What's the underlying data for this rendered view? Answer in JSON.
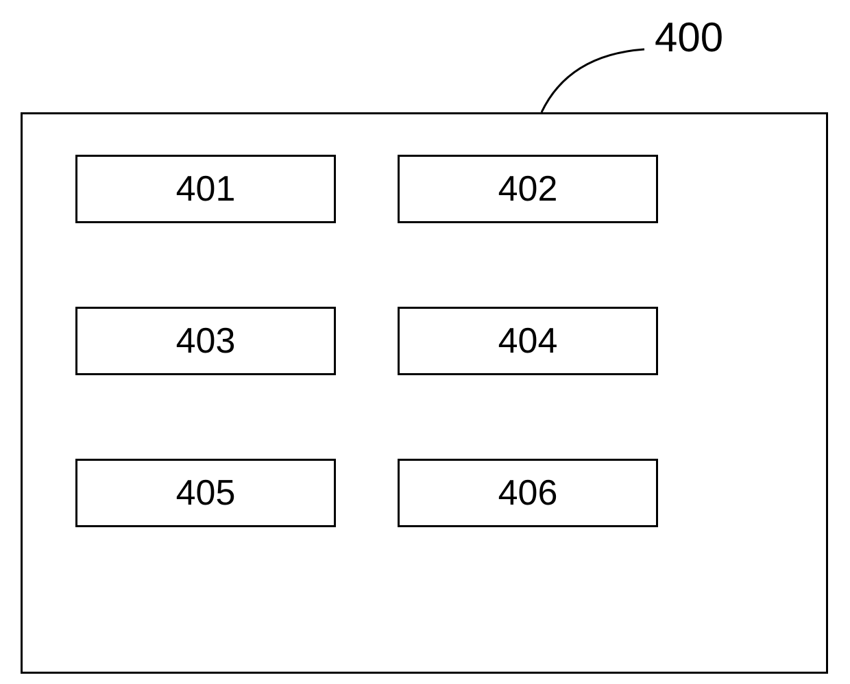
{
  "diagram": {
    "outer_label": "400",
    "boxes": [
      {
        "label": "401"
      },
      {
        "label": "402"
      },
      {
        "label": "403"
      },
      {
        "label": "404"
      },
      {
        "label": "405"
      },
      {
        "label": "406"
      }
    ]
  }
}
